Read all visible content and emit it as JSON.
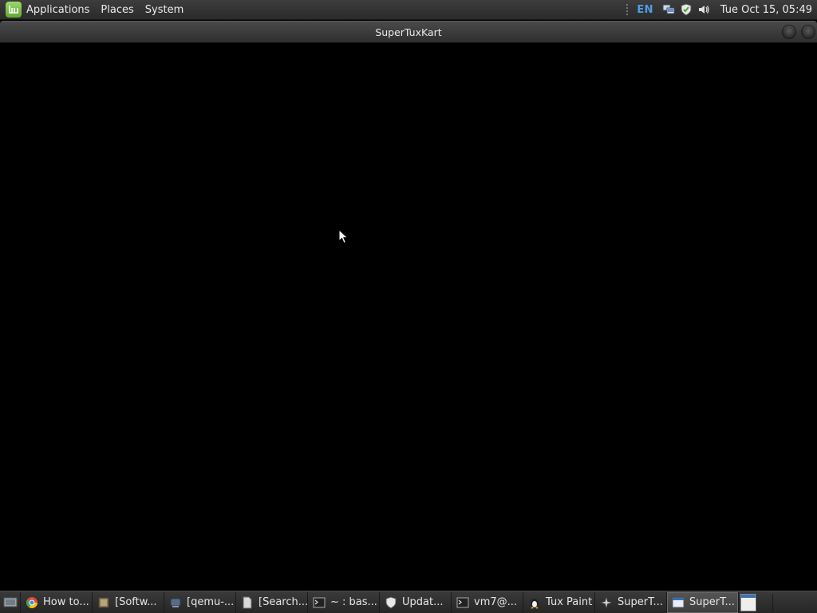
{
  "top_panel": {
    "menu": [
      "Applications",
      "Places",
      "System"
    ],
    "keyboard_layout": "EN",
    "clock": "Tue Oct 15, 05:49",
    "tray_icons": [
      "network-icon",
      "update-shield-icon",
      "volume-icon"
    ]
  },
  "window": {
    "title": "SuperTuxKart"
  },
  "taskbar": {
    "tasks": [
      {
        "label": "How to...",
        "icon": "chrome-icon",
        "active": false
      },
      {
        "label": "[Softw...",
        "icon": "software-manager-icon",
        "active": false
      },
      {
        "label": "[qemu-...",
        "icon": "qemu-icon",
        "active": false
      },
      {
        "label": "[Search...",
        "icon": "document-icon",
        "active": false
      },
      {
        "label": "~ : bas...",
        "icon": "terminal-icon",
        "active": false
      },
      {
        "label": "Updat...",
        "icon": "shield-icon",
        "active": false
      },
      {
        "label": "vm7@...",
        "icon": "terminal-icon",
        "active": false
      },
      {
        "label": "Tux Paint",
        "icon": "tux-paint-icon",
        "active": false
      },
      {
        "label": "SuperT...",
        "icon": "supertuxkart-icon",
        "active": false
      },
      {
        "label": "SuperT...",
        "icon": "window-icon",
        "active": true
      }
    ]
  }
}
